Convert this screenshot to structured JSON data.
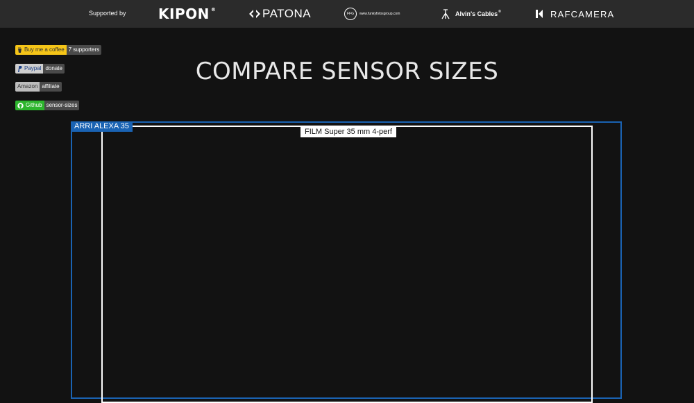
{
  "sponsors": {
    "label": "Supported by",
    "kipon": {
      "name": "KIPON",
      "mark": "®"
    },
    "patona": {
      "name": "PATONA"
    },
    "ffg": {
      "mark": "FFG",
      "url_text": "www.funkyfotosgroup.com"
    },
    "alvins": {
      "name": "Alvin's Cables",
      "mark": "®"
    },
    "rafcamera": {
      "name": "RAFCAMERA"
    }
  },
  "badges": {
    "coffee": {
      "left": "Buy me a coffee",
      "right": "7 supporters",
      "color": "#f5c518",
      "icon": "coffee-cup-icon"
    },
    "paypal": {
      "left": "Paypal",
      "right": "donate",
      "icon": "paypal-icon"
    },
    "amazon": {
      "left": "Amazon",
      "right": "affiliate"
    },
    "github": {
      "left": "Github",
      "right": "sensor-sizes",
      "color": "#2db52d",
      "icon": "github-icon"
    }
  },
  "title": "COMPARE SENSOR SIZES",
  "sensors": {
    "outer": {
      "label": "ARRI ALEXA 35",
      "color": "#1a63b3"
    },
    "inner": {
      "label": "FILM Super 35 mm 4-perf",
      "color": "#ffffff"
    }
  }
}
